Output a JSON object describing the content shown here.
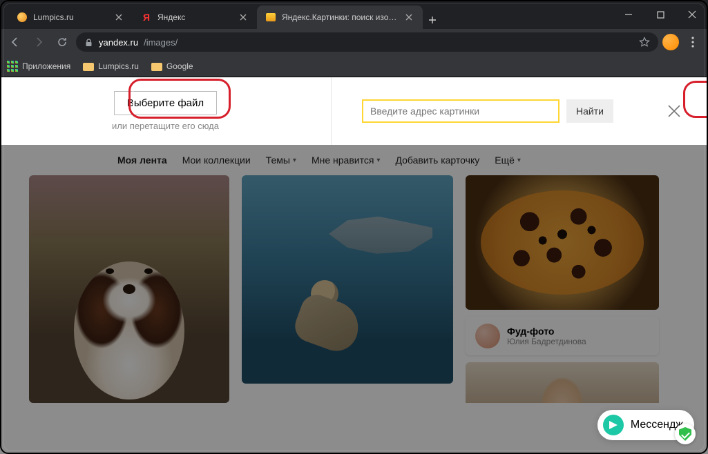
{
  "tabs": [
    {
      "title": "Lumpics.ru",
      "active": false,
      "favicon": "orange-dot"
    },
    {
      "title": "Яндекс",
      "active": false,
      "favicon": "yandex-y"
    },
    {
      "title": "Яндекс.Картинки: поиск изобра",
      "active": true,
      "favicon": "yandex-img"
    }
  ],
  "address": {
    "host": "yandex.ru",
    "path": "/images/"
  },
  "bookmarks": [
    {
      "label": "Приложения",
      "icon": "apps"
    },
    {
      "label": "Lumpics.ru",
      "icon": "folder"
    },
    {
      "label": "Google",
      "icon": "folder"
    }
  ],
  "upload": {
    "choose_file": "Выберите файл",
    "drag_hint": "или перетащите его сюда",
    "url_placeholder": "Введите адрес картинки",
    "find": "Найти"
  },
  "nav": {
    "feed": "Моя лента",
    "collections": "Мои коллекции",
    "topics": "Темы",
    "likes": "Мне нравится",
    "add_card": "Добавить карточку",
    "more": "Ещё"
  },
  "author_card": {
    "title": "Фуд-фото",
    "name": "Юлия Бадретдинова"
  },
  "messenger": {
    "label": "Мессендж"
  }
}
